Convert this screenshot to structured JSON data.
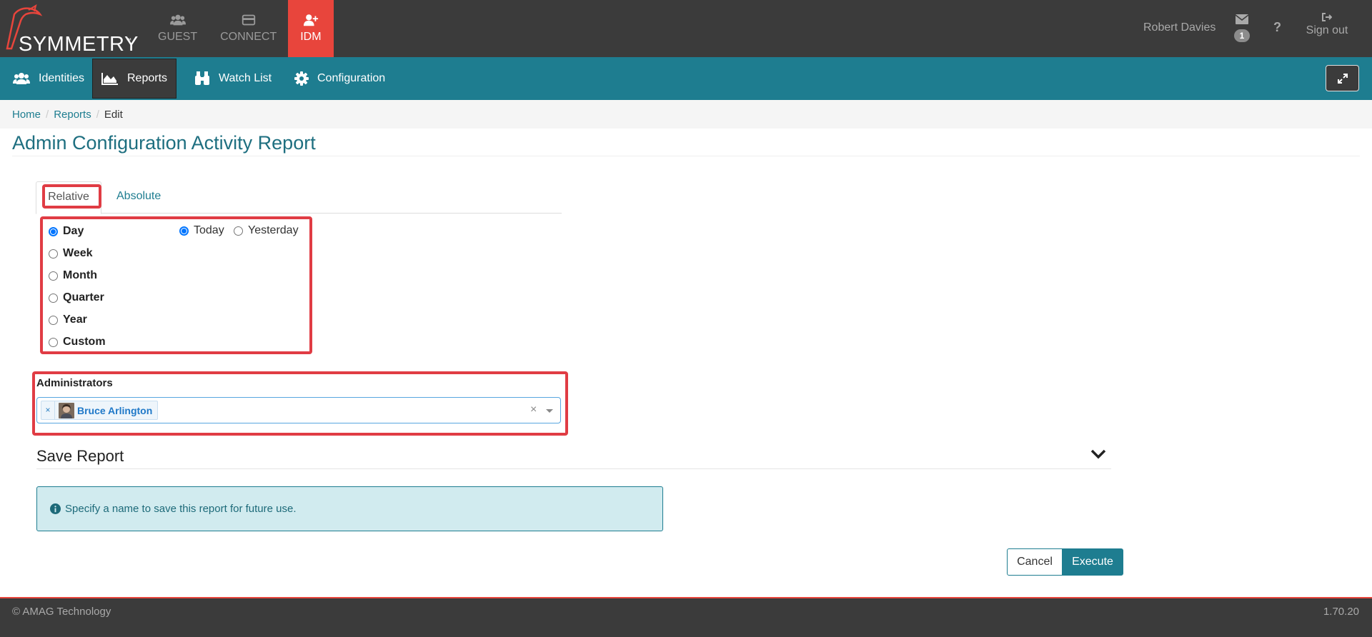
{
  "brand": {
    "name": "SYMMETRY",
    "tm": "™"
  },
  "top_nav": [
    {
      "label": "GUEST",
      "icon": "users-icon"
    },
    {
      "label": "CONNECT",
      "icon": "card-icon"
    },
    {
      "label": "IDM",
      "icon": "add-user-icon",
      "active": true
    }
  ],
  "user": {
    "name": "Robert Davies",
    "mail_count": "1",
    "help": "?",
    "sign_out": "Sign out"
  },
  "sub_nav": [
    {
      "label": "Identities",
      "icon": "users-icon"
    },
    {
      "label": "Reports",
      "icon": "area-chart-icon",
      "active": true
    },
    {
      "label": "Watch List",
      "icon": "binoculars-icon"
    },
    {
      "label": "Configuration",
      "icon": "gear-icon"
    }
  ],
  "breadcrumb": {
    "home": "Home",
    "reports": "Reports",
    "current": "Edit",
    "sep": "/"
  },
  "page_title": "Admin Configuration Activity Report",
  "tabs": {
    "relative": "Relative",
    "absolute": "Absolute"
  },
  "periods": [
    "Day",
    "Week",
    "Month",
    "Quarter",
    "Year",
    "Custom"
  ],
  "day_options": [
    "Today",
    "Yesterday"
  ],
  "administrators": {
    "label": "Administrators",
    "selected": "Bruce Arlington",
    "remove": "×",
    "clear": "×"
  },
  "save_report": {
    "title": "Save Report",
    "info": "Specify a name to save this report for future use."
  },
  "buttons": {
    "cancel": "Cancel",
    "execute": "Execute"
  },
  "footer": {
    "copyright": "© AMAG Technology",
    "version": "1.70.20"
  },
  "colors": {
    "teal": "#1e7d90",
    "dark": "#3b3b3b",
    "accent_red": "#e8453c",
    "highlight": "#e03c44"
  }
}
